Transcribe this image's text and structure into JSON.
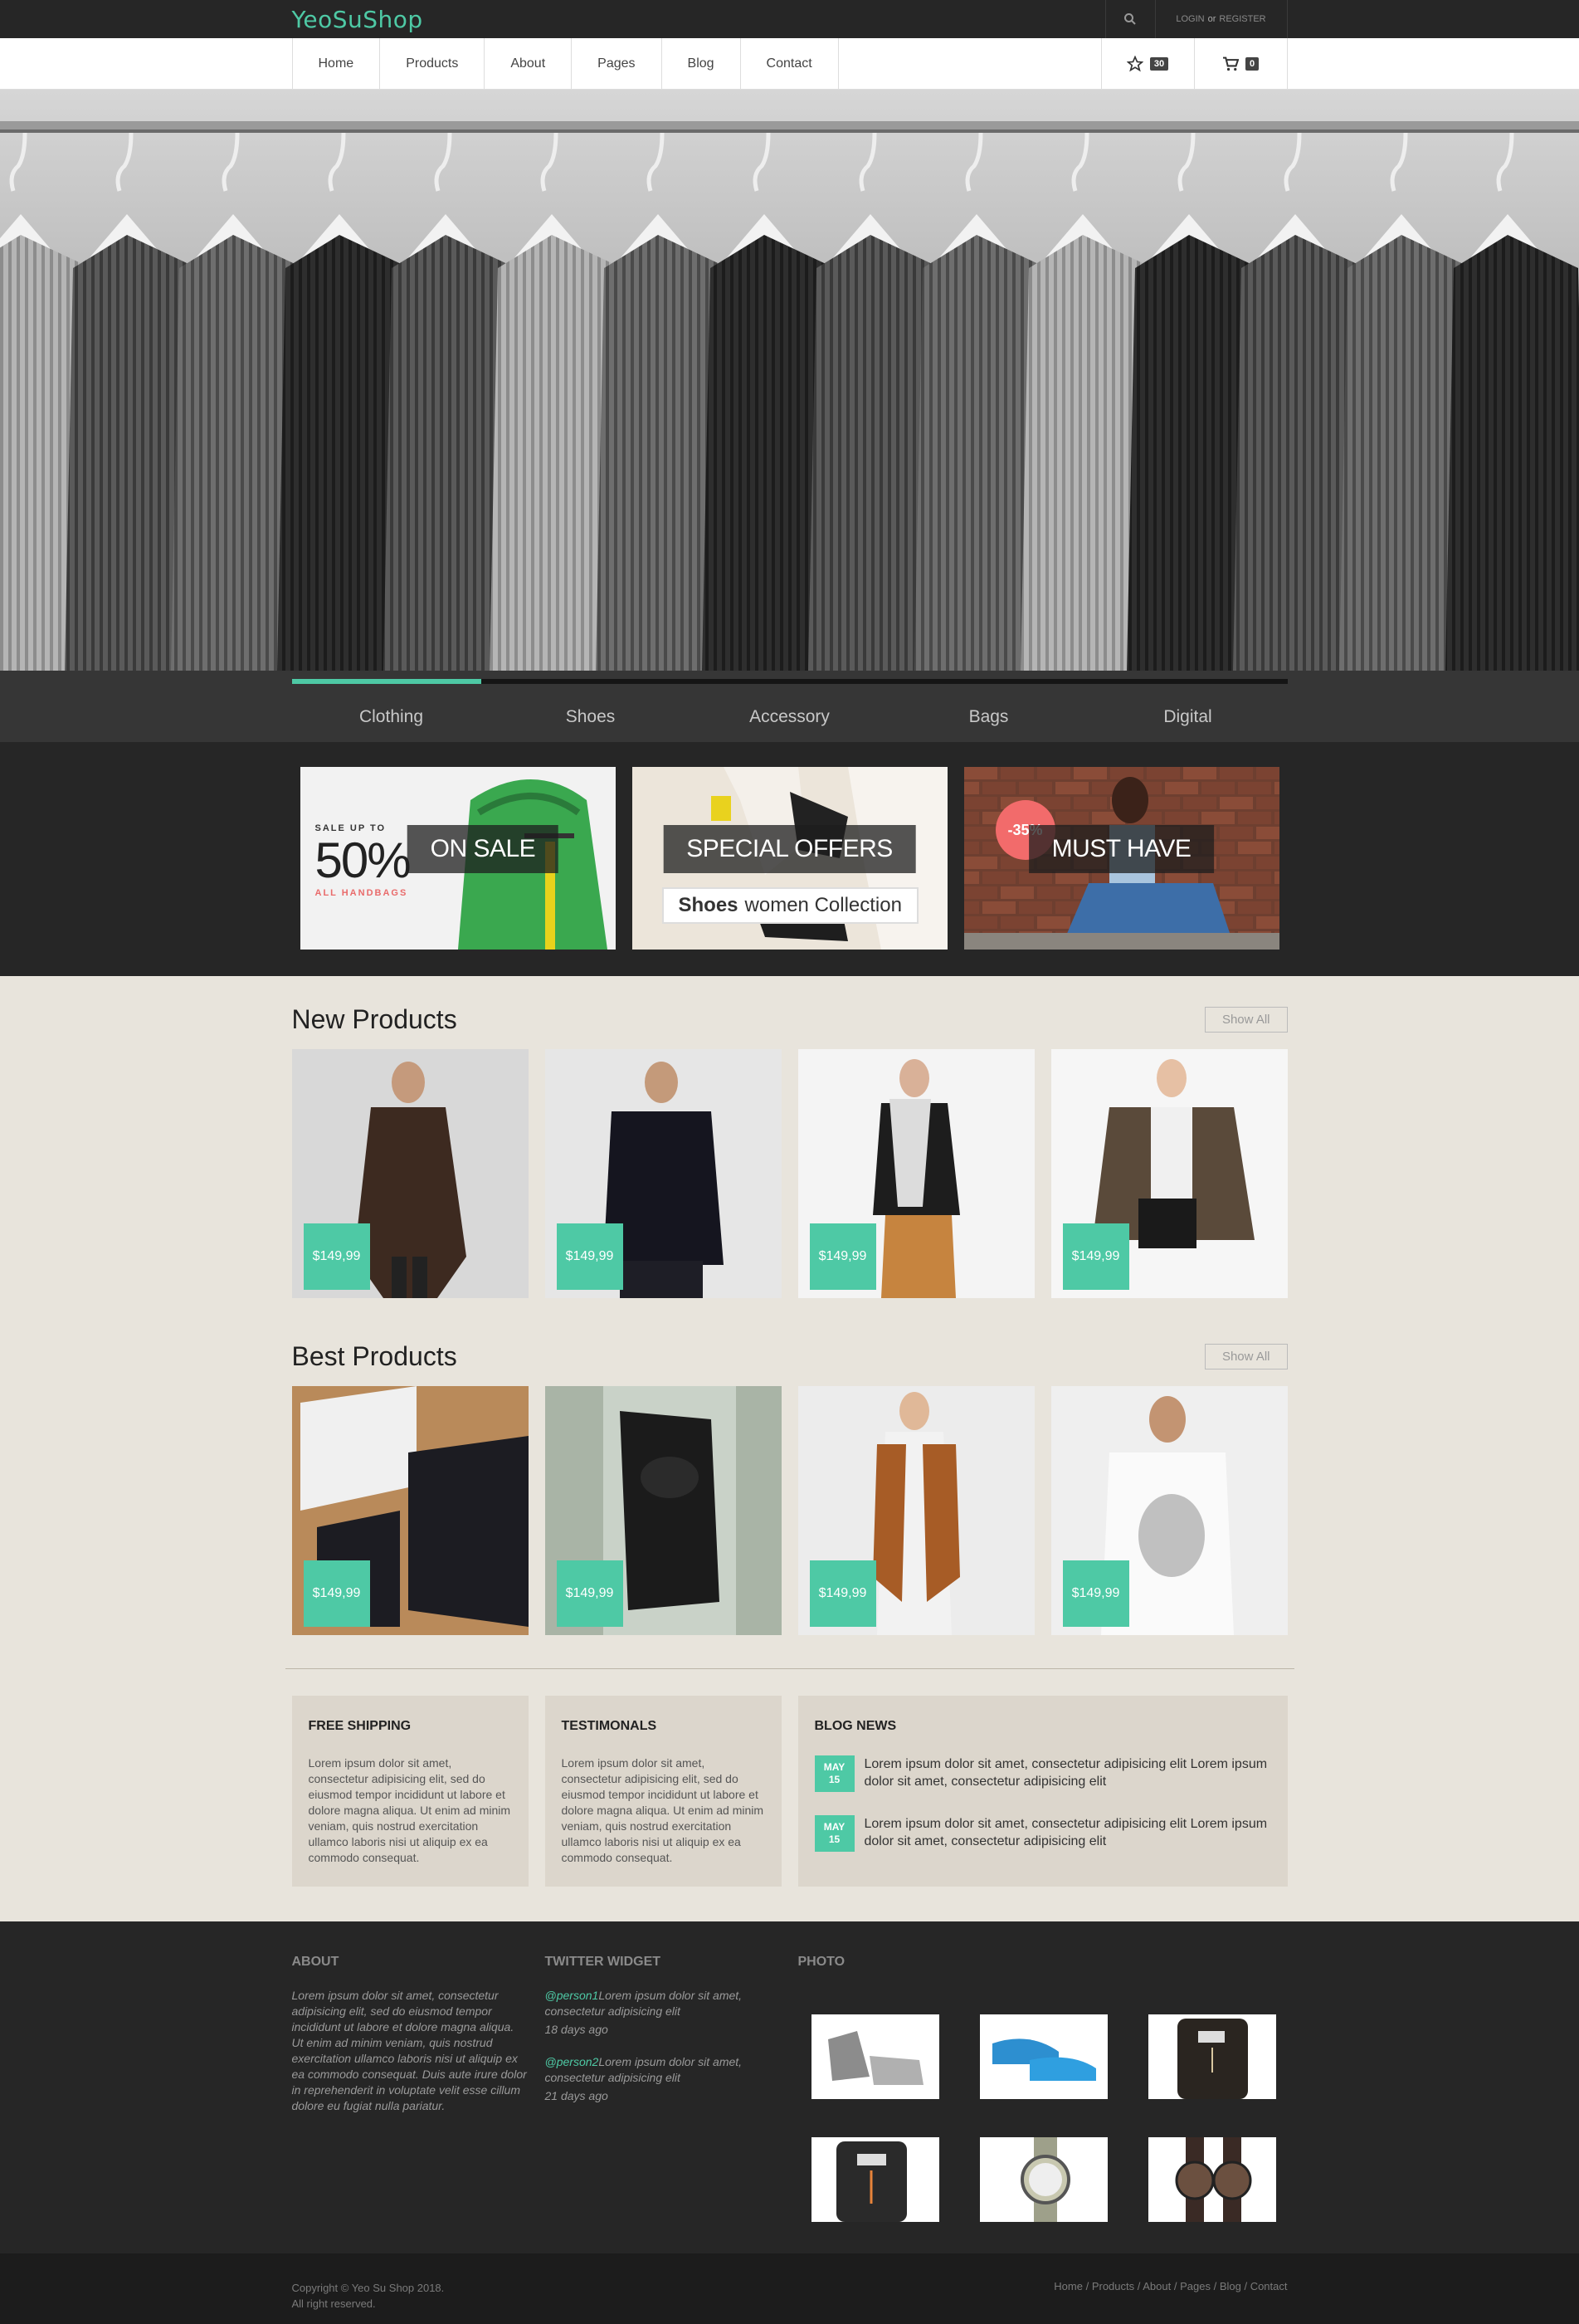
{
  "brand": {
    "name": "YeoSuShop",
    "accent": "#4ec9a5",
    "dark": "#262626",
    "sand": "#e8e4dc"
  },
  "topbar": {
    "login": "LOGIN",
    "or": "or",
    "register": "REGISTER",
    "search_icon": "search-icon"
  },
  "nav": {
    "items": [
      "Home",
      "Products",
      "About",
      "Pages",
      "Blog",
      "Contact"
    ],
    "wishlist_count": "30",
    "cart_count": "0"
  },
  "slider": {
    "progress": 0.19
  },
  "categories": [
    "Clothing",
    "Shoes",
    "Accessory",
    "Bags",
    "Digital"
  ],
  "promos": [
    {
      "caption": "ON SALE",
      "sale_up_to": "SALE UP TO",
      "big": "50%",
      "small": "ALL HANDBAGS"
    },
    {
      "caption": "SPECIAL OFFERS",
      "sub_bold": "Shoes",
      "sub": "women Collection"
    },
    {
      "caption": "MUST HAVE",
      "discount": "-35%"
    }
  ],
  "new_products": {
    "title": "New Products",
    "show_all": "Show All",
    "items": [
      {
        "price": "$149,99"
      },
      {
        "price": "$149,99"
      },
      {
        "price": "$149,99"
      },
      {
        "price": "$149,99"
      }
    ]
  },
  "best_products": {
    "title": "Best Products",
    "show_all": "Show All",
    "items": [
      {
        "price": "$149,99"
      },
      {
        "price": "$149,99"
      },
      {
        "price": "$149,99"
      },
      {
        "price": "$149,99"
      }
    ]
  },
  "info": {
    "shipping": {
      "title": "FREE SHIPPING",
      "text": "Lorem ipsum dolor sit amet, consectetur adipisicing elit, sed do eiusmod tempor incididunt ut labore et dolore magna aliqua. Ut enim ad minim veniam, quis nostrud exercitation ullamco laboris nisi ut aliquip ex ea commodo consequat."
    },
    "testimonials": {
      "title": "TESTIMONALS",
      "text": "Lorem ipsum dolor sit amet, consectetur adipisicing elit, sed do eiusmod tempor incididunt ut labore et dolore magna aliqua. Ut enim ad minim veniam, quis nostrud exercitation ullamco laboris nisi ut aliquip ex ea commodo consequat."
    },
    "blog": {
      "title": "BLOG NEWS",
      "items": [
        {
          "month": "MAY",
          "day": "15",
          "text": "Lorem ipsum dolor sit amet, consectetur adipisicing elit Lorem ipsum dolor sit amet, consectetur adipisicing elit"
        },
        {
          "month": "MAY",
          "day": "15",
          "text": "Lorem ipsum dolor sit amet, consectetur adipisicing elit Lorem ipsum dolor sit amet, consectetur adipisicing elit"
        }
      ]
    }
  },
  "footer": {
    "about": {
      "title": "ABOUT",
      "text": "Lorem ipsum dolor sit amet, consectetur adipisicing elit, sed do eiusmod tempor incididunt ut labore et dolore magna aliqua. Ut enim ad minim veniam, quis nostrud exercitation ullamco laboris nisi ut aliquip ex ea commodo consequat. Duis aute irure dolor in reprehenderit in voluptate velit esse cillum dolore eu fugiat nulla pariatur."
    },
    "twitter": {
      "title": "TWITTER WIDGET",
      "tweets": [
        {
          "handle": "@person1",
          "text": "Lorem ipsum dolor sit amet, consectetur adipisicing elit",
          "ago": "18 days ago"
        },
        {
          "handle": "@person2",
          "text": "Lorem ipsum dolor sit amet, consectetur adipisicing elit",
          "ago": "21 days ago"
        }
      ]
    },
    "photo": {
      "title": "PHOTO"
    },
    "copyright": "Copyright © Yeo Su Shop 2018.",
    "rights": "All right reserved.",
    "links": [
      "Home",
      "Products",
      "About",
      "Pages",
      "Blog",
      "Contact"
    ]
  }
}
